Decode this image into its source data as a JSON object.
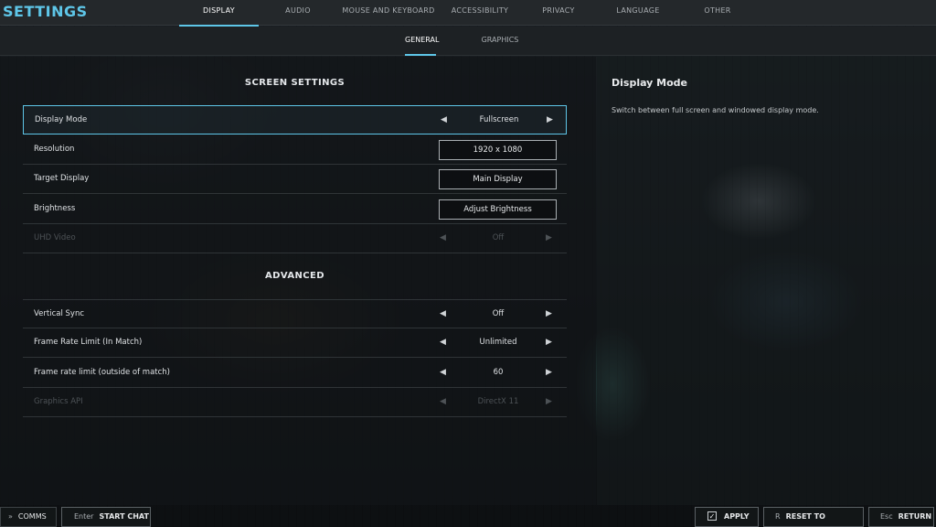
{
  "app": {
    "title": "SETTINGS"
  },
  "tabs": [
    {
      "label": "DISPLAY",
      "active": true
    },
    {
      "label": "AUDIO"
    },
    {
      "label": "MOUSE AND KEYBOARD"
    },
    {
      "label": "ACCESSIBILITY"
    },
    {
      "label": "PRIVACY"
    },
    {
      "label": "LANGUAGE"
    },
    {
      "label": "OTHER"
    }
  ],
  "subtabs": [
    {
      "label": "GENERAL",
      "active": true
    },
    {
      "label": "GRAPHICS"
    }
  ],
  "screen_settings": {
    "title": "SCREEN SETTINGS",
    "rows": [
      {
        "label": "Display Mode",
        "value": "Fullscreen",
        "control": "arrows",
        "selected": true
      },
      {
        "label": "Resolution",
        "value": "1920 x 1080",
        "control": "button"
      },
      {
        "label": "Target Display",
        "value": "Main Display",
        "control": "button"
      },
      {
        "label": "Brightness",
        "value": "Adjust Brightness",
        "control": "button"
      },
      {
        "label": "UHD Video",
        "value": "Off",
        "control": "arrows",
        "disabled": true
      }
    ]
  },
  "advanced": {
    "title": "ADVANCED",
    "rows": [
      {
        "label": "Vertical Sync",
        "value": "Off",
        "control": "arrows"
      },
      {
        "label": "Frame Rate Limit (In Match)",
        "value": "Unlimited",
        "control": "arrows"
      },
      {
        "label": "Frame rate limit (outside of match)",
        "value": "60",
        "control": "arrows"
      },
      {
        "label": "Graphics API",
        "value": "DirectX 11",
        "control": "arrows",
        "disabled": true
      }
    ]
  },
  "description": {
    "title": "Display Mode",
    "text": "Switch between full screen and windowed display mode."
  },
  "arrows": {
    "left": "◀",
    "right": "▶"
  },
  "bottom": {
    "comms": "COMMS",
    "chat_key": "Enter",
    "chat_label": "START CHAT",
    "apply_label": "APPLY",
    "apply_check": "✓",
    "reset_key": "R",
    "reset_label": "RESET TO DEFAULT",
    "return_key": "Esc",
    "return_label": "RETURN"
  },
  "colors": {
    "accent": "#5ec6e8",
    "disabled": "#4d5256"
  }
}
